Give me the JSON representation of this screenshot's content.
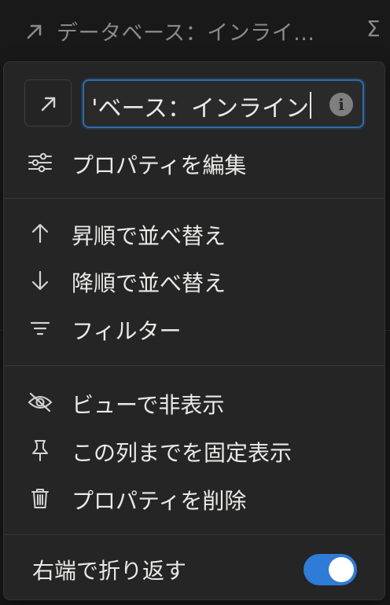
{
  "header": {
    "title": "データベース：インライ...",
    "sigma": "Σ"
  },
  "menu": {
    "name_value": "'ベース：インライン",
    "items": [
      {
        "label": "プロパティを編集",
        "icon": "sliders-icon"
      },
      {
        "label": "昇順で並べ替え",
        "icon": "arrow-up-icon"
      },
      {
        "label": "降順で並べ替え",
        "icon": "arrow-down-icon"
      },
      {
        "label": "フィルター",
        "icon": "filter-icon"
      },
      {
        "label": "ビューで非表示",
        "icon": "eye-off-icon"
      },
      {
        "label": "この列までを固定表示",
        "icon": "pin-icon"
      },
      {
        "label": "プロパティを削除",
        "icon": "trash-icon"
      }
    ],
    "wrap_label": "右端で折り返す",
    "wrap_enabled": true,
    "accent_color": "#2e7bd8"
  }
}
